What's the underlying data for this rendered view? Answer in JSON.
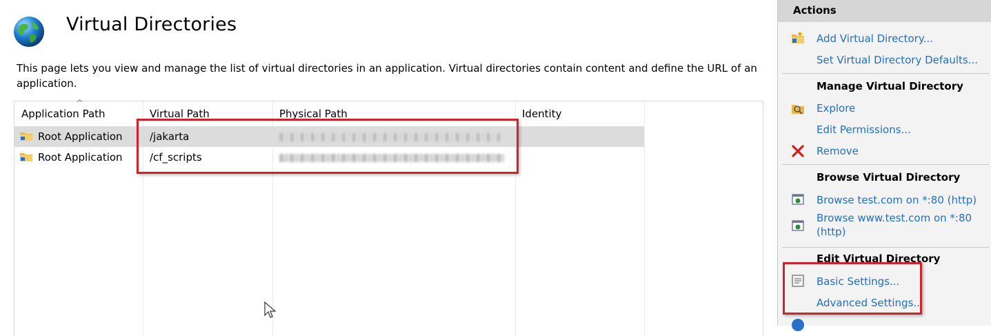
{
  "page": {
    "title": "Virtual Directories",
    "description": "This page lets you view and manage the list of virtual directories in an application. Virtual directories contain content and define the URL of an application."
  },
  "table": {
    "columns": [
      "Application Path",
      "Virtual Path",
      "Physical Path",
      "Identity"
    ],
    "sorted_column": "Application Path",
    "rows": [
      {
        "application_path": "Root Application",
        "virtual_path": "/jakarta",
        "identity": "",
        "selected": true
      },
      {
        "application_path": "Root Application",
        "virtual_path": "/cf_scripts",
        "identity": "",
        "selected": false
      }
    ]
  },
  "actions": {
    "title": "Actions",
    "add_virtual_directory": "Add Virtual Directory...",
    "set_defaults": "Set Virtual Directory Defaults...",
    "manage": {
      "title": "Manage Virtual Directory",
      "explore": "Explore",
      "edit_permissions": "Edit Permissions...",
      "remove": "Remove"
    },
    "browse": {
      "title": "Browse Virtual Directory",
      "item1": "Browse test.com on *:80 (http)",
      "item2_line1": "Browse www.test.com on *:80",
      "item2_line2": "(http)"
    },
    "edit": {
      "title": "Edit Virtual Directory",
      "basic_settings": "Basic Settings...",
      "advanced_settings": "Advanced Settings..."
    }
  },
  "colors": {
    "link": "#1f6fc5",
    "highlight_box": "#d2212b",
    "selected_row": "#dcdcdc",
    "actions_header": "#d6d6d6"
  },
  "icons": [
    "globe-icon",
    "folder-app-icon",
    "add-folder-icon",
    "explore-icon",
    "remove-icon",
    "browse-icon",
    "basic-settings-icon",
    "mouse-cursor-icon"
  ]
}
